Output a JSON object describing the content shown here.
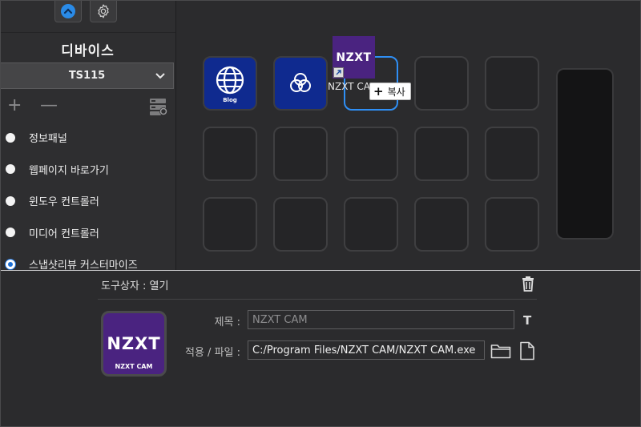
{
  "sidebar": {
    "device_title": "디바이스",
    "device_select": "TS115",
    "tools": {
      "add": "+",
      "remove": "—"
    },
    "categories": [
      {
        "label": "정보패널",
        "selected": false
      },
      {
        "label": "웹페이지 바로가기",
        "selected": false
      },
      {
        "label": "윈도우 컨트롤러",
        "selected": false
      },
      {
        "label": "미디어 컨트롤러",
        "selected": false
      },
      {
        "label": "스냅샷리뷰 커스터마이즈",
        "selected": true
      }
    ]
  },
  "grid": {
    "key1_label": "Blog",
    "drag_icon_logo": "NZXT",
    "drag_label": "NZXT CAM",
    "copy_badge_icon": "+",
    "copy_badge_label": "복사"
  },
  "bottom": {
    "title": "도구상자 : 열기",
    "preview_logo": "NZXT",
    "preview_caption": "NZXT CAM",
    "title_label": "제목 :",
    "title_placeholder": "NZXT CAM",
    "path_label": "적용 / 파일 :",
    "path_value": "C:/Program Files/NZXT CAM/NZXT CAM.exe",
    "t_icon": "T"
  },
  "colors": {
    "accent": "#2f8ff5",
    "key_fill": "#0f2a8f",
    "nzxt_purple": "#4a2380",
    "background": "#2b2b2d"
  },
  "icons": [
    "home-icon",
    "gear-icon",
    "chevron-down-icon",
    "device-settings-icon",
    "globe-icon",
    "circles-icon",
    "shortcut-arrow-icon",
    "trash-icon",
    "text-icon",
    "folder-icon",
    "file-icon"
  ]
}
